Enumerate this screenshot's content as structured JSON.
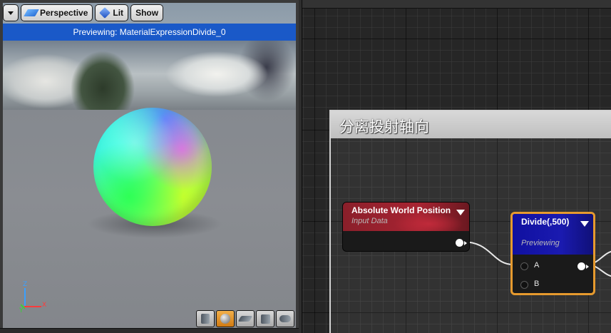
{
  "viewport": {
    "toolbar": {
      "dropdown_icon": "chevron-down-icon",
      "perspective_label": "Perspective",
      "lit_label": "Lit",
      "show_label": "Show"
    },
    "preview_text": "Previewing: MaterialExpressionDivide_0",
    "axis": {
      "z": "Z",
      "x": "X",
      "y": "Y"
    },
    "tools": [
      {
        "name": "cylinder-preview-button",
        "icon": "cylinder-icon",
        "active": false
      },
      {
        "name": "sphere-preview-button",
        "icon": "sphere-icon",
        "active": true
      },
      {
        "name": "plane-preview-button",
        "icon": "plane-icon",
        "active": false
      },
      {
        "name": "cube-preview-button",
        "icon": "cube-icon",
        "active": false
      },
      {
        "name": "custom-mesh-preview-button",
        "icon": "teapot-icon",
        "active": false
      }
    ]
  },
  "graph": {
    "comment_title": "分离投射轴向",
    "nodes": {
      "absolute_world_position": {
        "title": "Absolute World Position",
        "subtitle": "Input Data",
        "header_color": "#8a1f2a"
      },
      "divide": {
        "title": "Divide(,500)",
        "subtitle": "Previewing",
        "header_color": "#1a1aa8",
        "pin_a": "A",
        "pin_b": "B",
        "highlight_color": "#e69a2e"
      }
    }
  },
  "colors": {
    "preview_bar": "#1a59c8",
    "graph_background": "#262626",
    "comment_border": "#d2d2d2"
  }
}
